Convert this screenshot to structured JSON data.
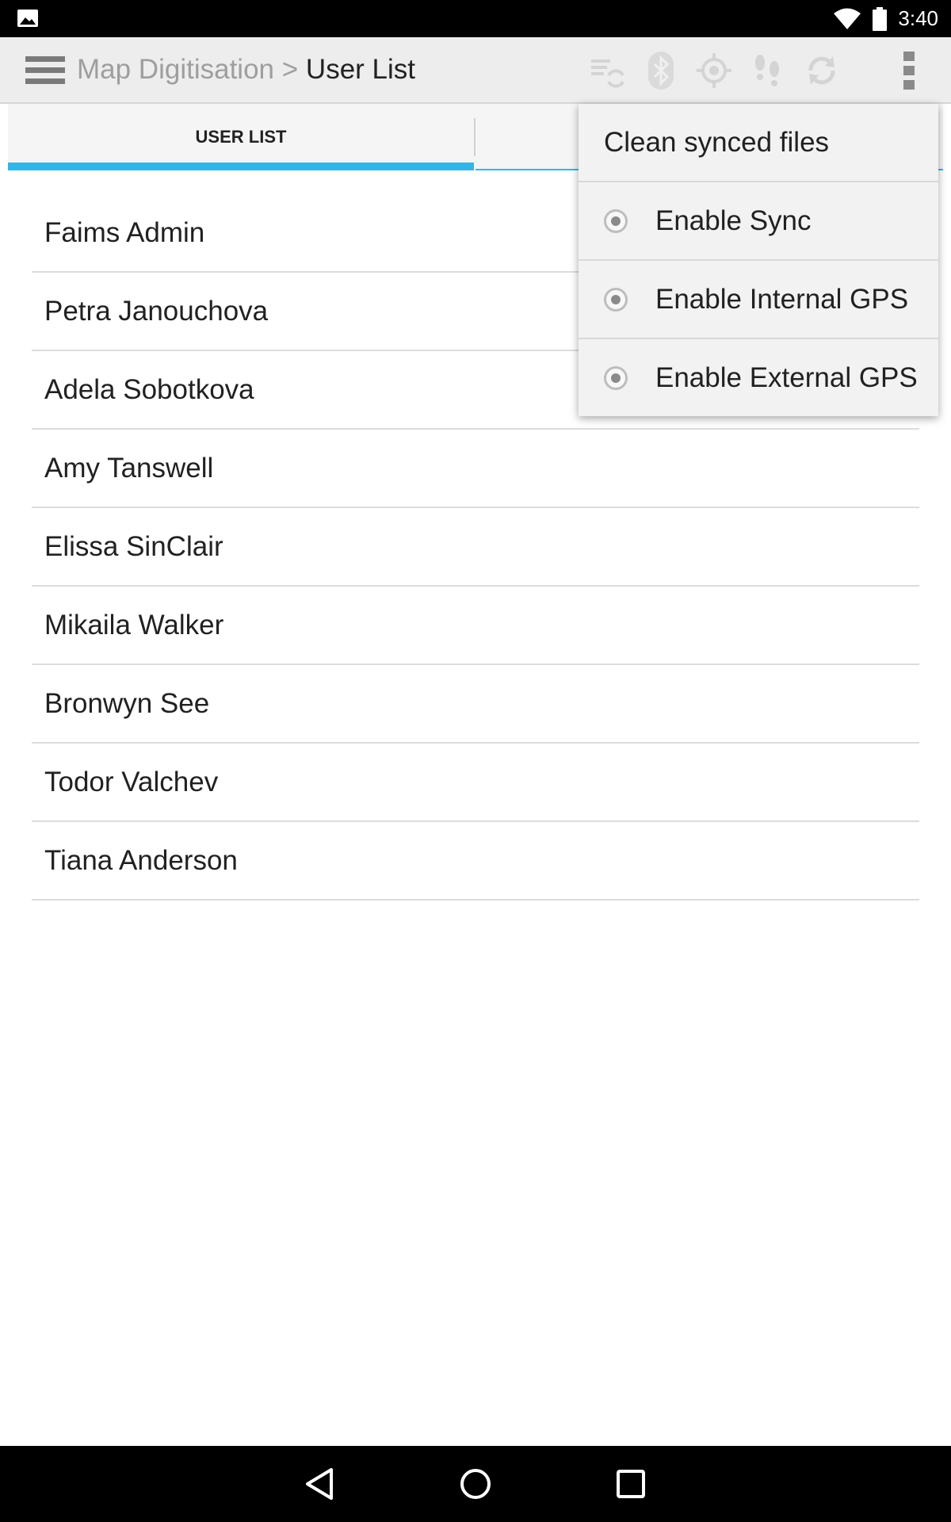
{
  "status_bar": {
    "time": "3:40",
    "icons": [
      "gallery-notification-icon",
      "wifi-icon",
      "battery-icon"
    ]
  },
  "action_bar": {
    "breadcrumb_parent": "Map Digitisation",
    "separator": ">",
    "current": "User List",
    "icons": [
      "menu-drawer-icon",
      "sync-files-icon",
      "bluetooth-icon",
      "gps-target-icon",
      "tracking-footsteps-icon",
      "refresh-sync-icon",
      "overflow-menu-icon"
    ]
  },
  "tabs": [
    {
      "label": "USER LIST",
      "selected": true
    },
    {
      "label": "",
      "selected": false
    }
  ],
  "users": [
    "Faims Admin",
    "Petra Janouchova",
    "Adela Sobotkova",
    "Amy Tanswell",
    "Elissa SinClair",
    "Mikaila Walker",
    "Bronwyn See",
    "Todor  Valchev",
    "Tiana Anderson"
  ],
  "overflow_menu": {
    "items": [
      {
        "label": "Clean synced files",
        "type": "plain"
      },
      {
        "label": "Enable Sync",
        "type": "radio"
      },
      {
        "label": "Enable Internal GPS",
        "type": "radio"
      },
      {
        "label": "Enable External GPS",
        "type": "radio"
      }
    ]
  },
  "nav_bar": {
    "icons": [
      "back-icon",
      "home-icon",
      "recents-icon"
    ]
  },
  "colors": {
    "accent": "#33b5e5",
    "action_bar_bg": "#ededed",
    "disabled_icon": "#d4d4d4"
  }
}
